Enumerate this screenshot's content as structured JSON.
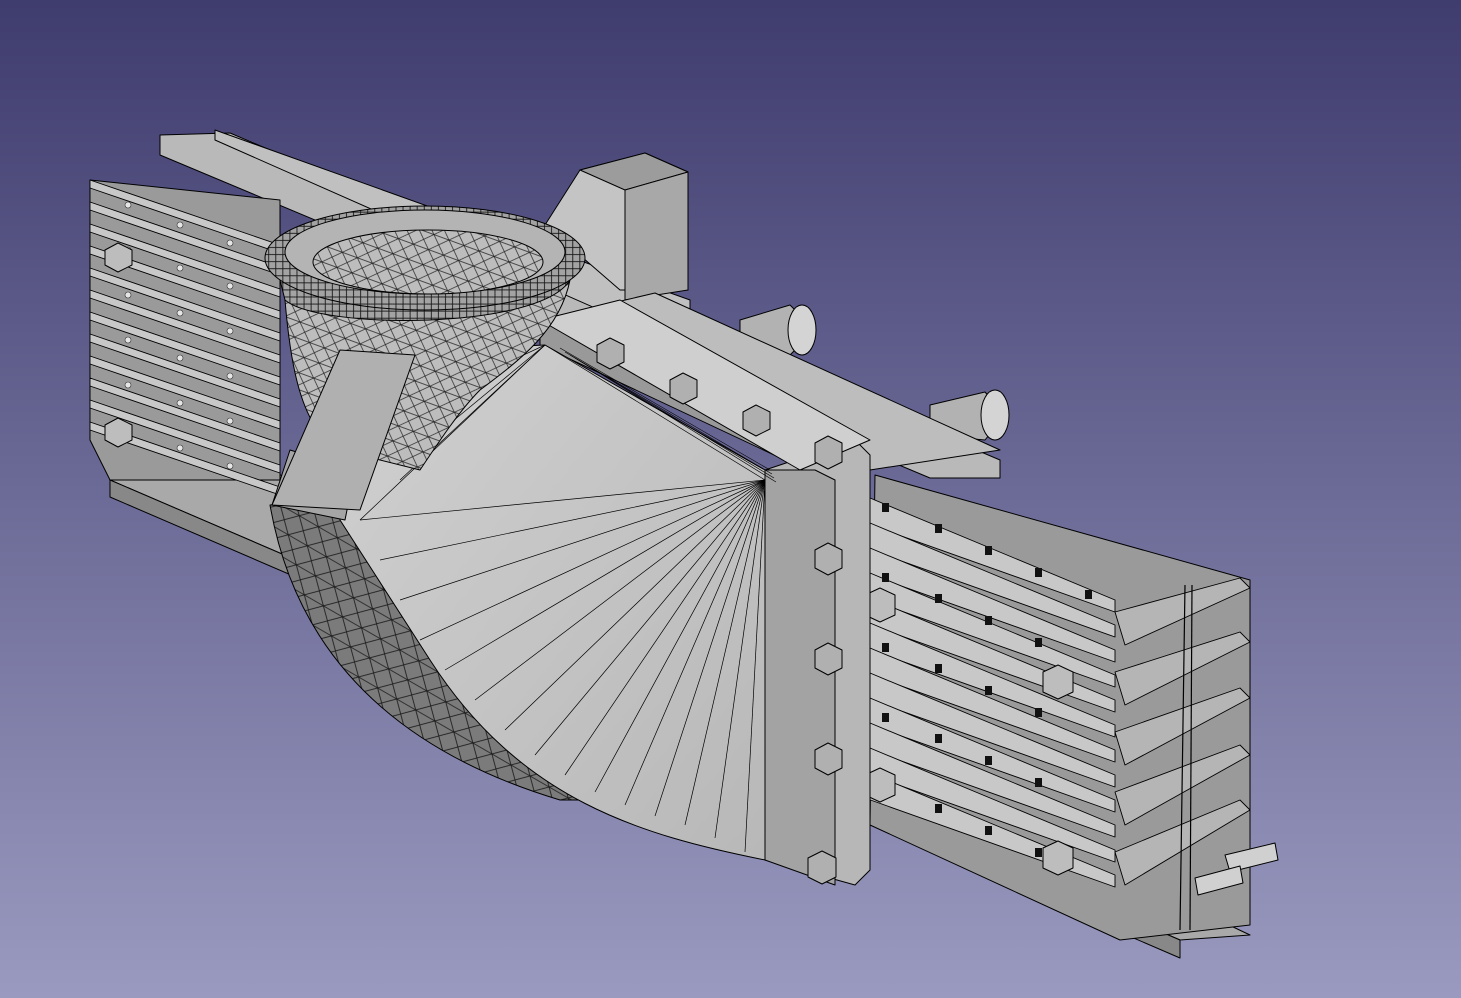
{
  "viewport": {
    "background_top": "#3f3c6e",
    "background_bottom": "#9a9ac0"
  },
  "model": {
    "face_color": "#c6c6c6",
    "edge_color": "#000000",
    "shadow_color": "#8a8a8a",
    "display_mode": "flat lines"
  }
}
